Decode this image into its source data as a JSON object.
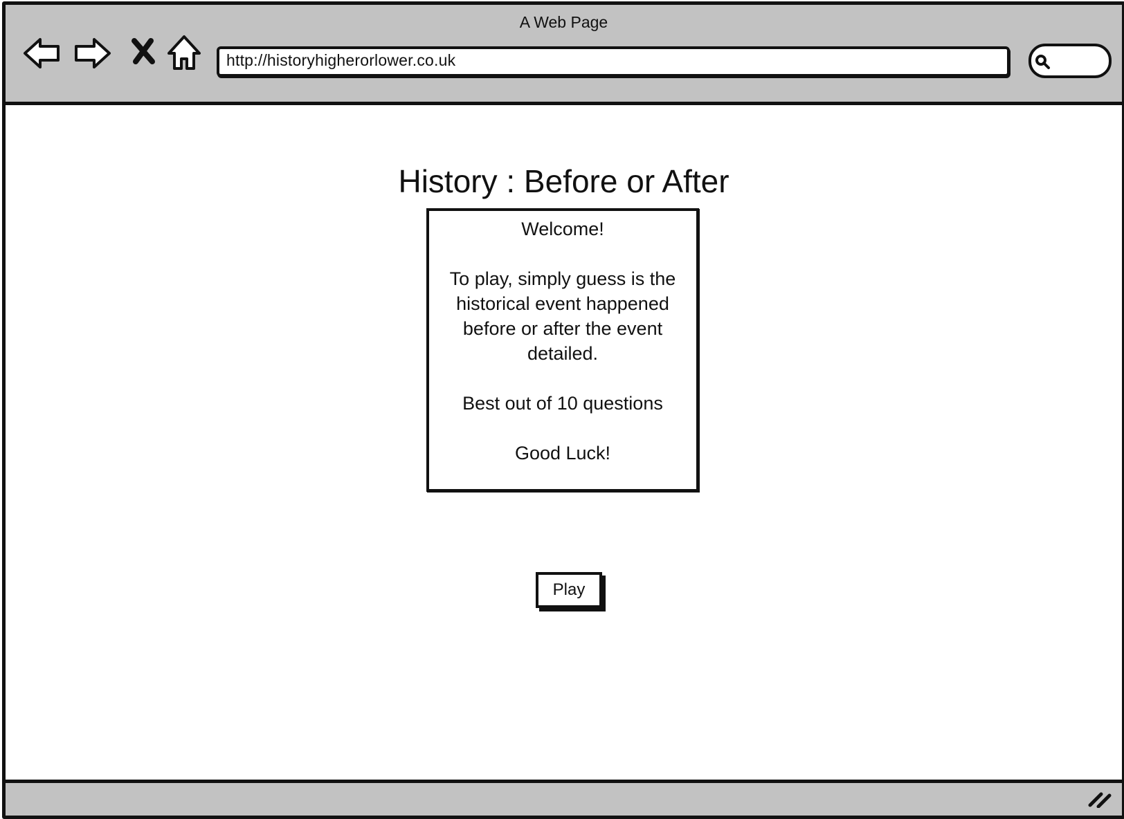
{
  "window": {
    "title": "A Web Page"
  },
  "browser": {
    "url": "http://historyhigherorlower.co.uk",
    "nav": {
      "back_icon": "back-arrow-icon",
      "forward_icon": "forward-arrow-icon",
      "stop_icon": "close-icon",
      "home_icon": "home-icon",
      "search_icon": "search-icon"
    }
  },
  "page": {
    "heading": "History : Before or After",
    "welcome": {
      "title": "Welcome!",
      "instructions": "To play, simply guess is the historical event happened before or after the event detailed.",
      "best_of": "Best out of 10 questions",
      "good_luck": "Good Luck!"
    },
    "play_label": "Play"
  },
  "colors": {
    "chrome": "#c2c2c2",
    "stroke": "#111111",
    "background": "#ffffff"
  }
}
